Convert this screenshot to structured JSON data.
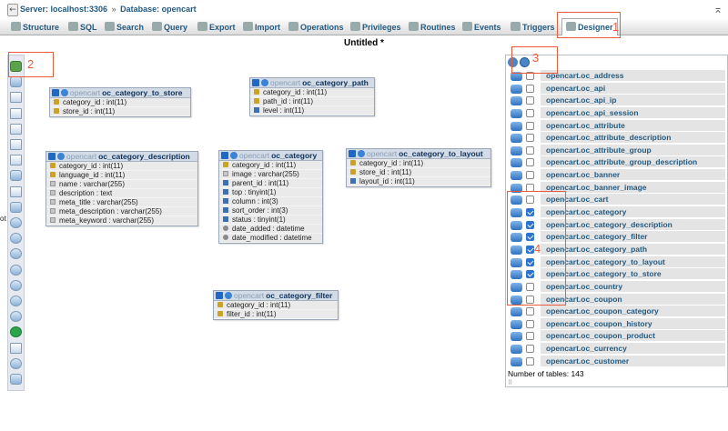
{
  "breadcrumb": {
    "server": "Server: localhost:3306",
    "separator": "»",
    "database": "Database: opencart"
  },
  "tabs": [
    {
      "label": "Structure",
      "icon": "structure-icon"
    },
    {
      "label": "SQL",
      "icon": "sql-icon"
    },
    {
      "label": "Search",
      "icon": "search-icon"
    },
    {
      "label": "Query",
      "icon": "query-icon"
    },
    {
      "label": "Export",
      "icon": "export-icon"
    },
    {
      "label": "Import",
      "icon": "import-icon"
    },
    {
      "label": "Operations",
      "icon": "operations-icon"
    },
    {
      "label": "Privileges",
      "icon": "privileges-icon"
    },
    {
      "label": "Routines",
      "icon": "routines-icon"
    },
    {
      "label": "Events",
      "icon": "events-icon"
    },
    {
      "label": "Triggers",
      "icon": "triggers-icon"
    },
    {
      "label": "Designer",
      "icon": "designer-icon",
      "active": true
    }
  ],
  "title": "Untitled *",
  "annotations": [
    "1",
    "2",
    "3",
    "4"
  ],
  "side_text": "ot",
  "designer_tables": [
    {
      "db": "opencart",
      "name": "oc_category_to_store",
      "columns": [
        {
          "text": "category_id : int(11)",
          "kind": "key"
        },
        {
          "text": "store_id : int(11)",
          "kind": "key"
        }
      ]
    },
    {
      "db": "opencart",
      "name": "oc_category_path",
      "columns": [
        {
          "text": "category_id : int(11)",
          "kind": "key"
        },
        {
          "text": "path_id : int(11)",
          "kind": "key"
        },
        {
          "text": "level : int(11)",
          "kind": "num"
        }
      ]
    },
    {
      "db": "opencart",
      "name": "oc_category_description",
      "columns": [
        {
          "text": "category_id : int(11)",
          "kind": "key"
        },
        {
          "text": "language_id : int(11)",
          "kind": "key"
        },
        {
          "text": "name : varchar(255)",
          "kind": "txt"
        },
        {
          "text": "description : text",
          "kind": "txt"
        },
        {
          "text": "meta_title : varchar(255)",
          "kind": "txt"
        },
        {
          "text": "meta_description : varchar(255)",
          "kind": "txt"
        },
        {
          "text": "meta_keyword : varchar(255)",
          "kind": "txt"
        }
      ]
    },
    {
      "db": "opencart",
      "name": "oc_category",
      "columns": [
        {
          "text": "category_id : int(11)",
          "kind": "key"
        },
        {
          "text": "image : varchar(255)",
          "kind": "txt"
        },
        {
          "text": "parent_id : int(11)",
          "kind": "num"
        },
        {
          "text": "top : tinyint(1)",
          "kind": "num"
        },
        {
          "text": "column : int(3)",
          "kind": "num"
        },
        {
          "text": "sort_order : int(3)",
          "kind": "num"
        },
        {
          "text": "status : tinyint(1)",
          "kind": "num"
        },
        {
          "text": "date_added : datetime",
          "kind": "dt"
        },
        {
          "text": "date_modified : datetime",
          "kind": "dt"
        }
      ]
    },
    {
      "db": "opencart",
      "name": "oc_category_to_layout",
      "columns": [
        {
          "text": "category_id : int(11)",
          "kind": "key"
        },
        {
          "text": "store_id : int(11)",
          "kind": "key"
        },
        {
          "text": "layout_id : int(11)",
          "kind": "num"
        }
      ]
    },
    {
      "db": "opencart",
      "name": "oc_category_filter",
      "columns": [
        {
          "text": "category_id : int(11)",
          "kind": "key"
        },
        {
          "text": "filter_id : int(11)",
          "kind": "key"
        }
      ]
    }
  ],
  "table_list": [
    {
      "name": "opencart.oc_address",
      "checked": false
    },
    {
      "name": "opencart.oc_api",
      "checked": false
    },
    {
      "name": "opencart.oc_api_ip",
      "checked": false
    },
    {
      "name": "opencart.oc_api_session",
      "checked": false
    },
    {
      "name": "opencart.oc_attribute",
      "checked": false
    },
    {
      "name": "opencart.oc_attribute_description",
      "checked": false
    },
    {
      "name": "opencart.oc_attribute_group",
      "checked": false
    },
    {
      "name": "opencart.oc_attribute_group_description",
      "checked": false
    },
    {
      "name": "opencart.oc_banner",
      "checked": false
    },
    {
      "name": "opencart.oc_banner_image",
      "checked": false
    },
    {
      "name": "opencart.oc_cart",
      "checked": false
    },
    {
      "name": "opencart.oc_category",
      "checked": true
    },
    {
      "name": "opencart.oc_category_description",
      "checked": true
    },
    {
      "name": "opencart.oc_category_filter",
      "checked": true
    },
    {
      "name": "opencart.oc_category_path",
      "checked": true
    },
    {
      "name": "opencart.oc_category_to_layout",
      "checked": true
    },
    {
      "name": "opencart.oc_category_to_store",
      "checked": true
    },
    {
      "name": "opencart.oc_country",
      "checked": false
    },
    {
      "name": "opencart.oc_coupon",
      "checked": false
    },
    {
      "name": "opencart.oc_coupon_category",
      "checked": false
    },
    {
      "name": "opencart.oc_coupon_history",
      "checked": false
    },
    {
      "name": "opencart.oc_coupon_product",
      "checked": false
    },
    {
      "name": "opencart.oc_currency",
      "checked": false
    },
    {
      "name": "opencart.oc_customer",
      "checked": false
    }
  ],
  "table_count": "Number of tables: 143",
  "colors": {
    "link": "#235a81",
    "highlight": "#ea5a3b",
    "checkbox": "#2c73d2"
  }
}
